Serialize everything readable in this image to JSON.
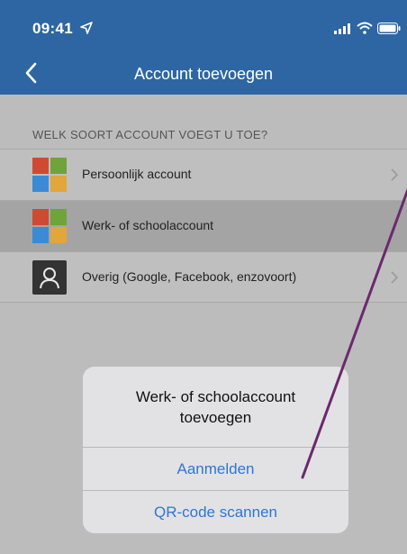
{
  "status": {
    "time": "09:41"
  },
  "nav": {
    "title": "Account toevoegen"
  },
  "list": {
    "header": "WELK SOORT ACCOUNT VOEGT U TOE?",
    "items": [
      {
        "label": "Persoonlijk account",
        "icon": "microsoft-logo-icon"
      },
      {
        "label": "Werk- of schoolaccount",
        "icon": "microsoft-logo-icon"
      },
      {
        "label": "Overig (Google, Facebook, enzovoort)",
        "icon": "person-icon"
      }
    ]
  },
  "sheet": {
    "title": "Werk- of schoolaccount toevoegen",
    "actions": [
      "Aanmelden",
      "QR-code scannen"
    ]
  },
  "colors": {
    "header_blue": "#2d66a3",
    "action_blue": "#2f76d2",
    "annotation_purple": "#6a2a6e",
    "ms_red": "#d04a32",
    "ms_green": "#6fa43a",
    "ms_blue": "#3a8ad6",
    "ms_yellow": "#e2a63a"
  }
}
